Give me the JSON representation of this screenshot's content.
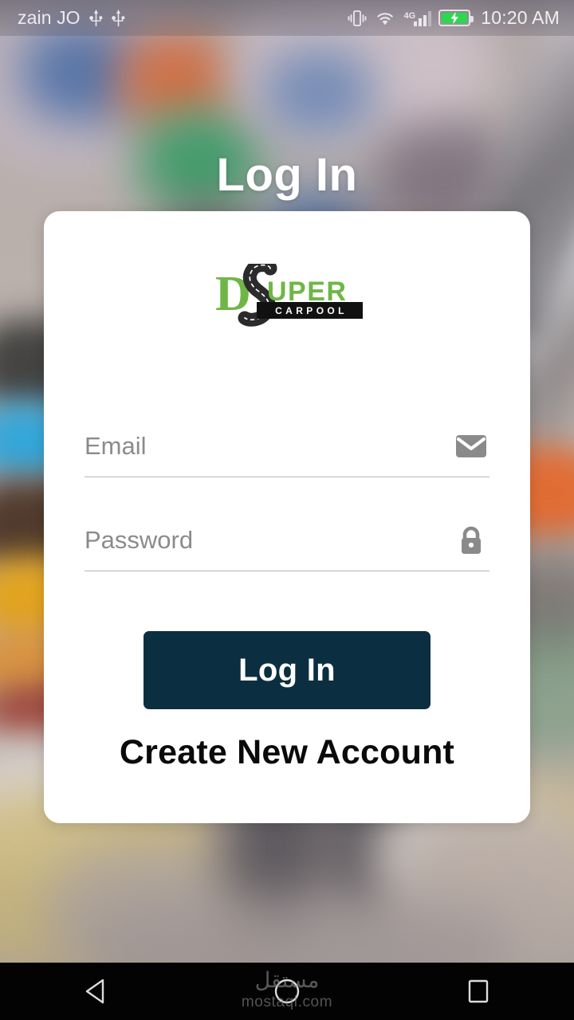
{
  "status_bar": {
    "carrier": "zain JO",
    "network_type": "4G",
    "clock": "10:20 AM",
    "icons": [
      "usb-icon",
      "usb-icon",
      "vibrate-icon",
      "wifi-icon",
      "signal-bars-icon",
      "battery-charging-icon"
    ],
    "battery_color": "#2bd84e",
    "signal_bars": 4
  },
  "header": {
    "title": "Log In"
  },
  "logo": {
    "letter_d": "D",
    "word_upper": "UPER",
    "tagline": "CARPOOL",
    "green": "#6FB646",
    "bar_color": "#111111",
    "road_color": "#2b2b2b"
  },
  "form": {
    "email": {
      "label": "Email",
      "placeholder": "Email",
      "value": "",
      "icon": "envelope-icon"
    },
    "password": {
      "label": "Password",
      "placeholder": "Password",
      "value": "",
      "icon": "lock-icon"
    },
    "submit_label": "Log In",
    "submit_color": "#0B2F40",
    "create_account_label": "Create New Account"
  },
  "nav_bar": {
    "back_label": "back-button",
    "home_label": "home-button",
    "recents_label": "recents-button"
  },
  "watermark": {
    "arabic": "مستقل",
    "latin": "mostaql.com"
  }
}
